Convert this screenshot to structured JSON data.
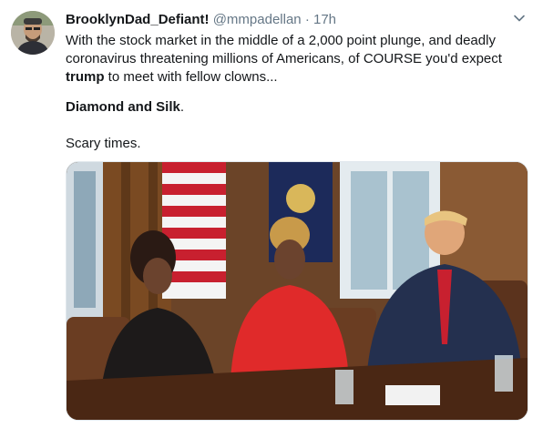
{
  "tweet": {
    "display_name": "BrooklynDad_Defiant!",
    "handle": "@mmpadellan",
    "separator": "·",
    "time": "17h",
    "text": {
      "line1_before": "With the stock market in the middle of a 2,000 point plunge, and deadly coronavirus threatening millions of Americans, of COURSE you'd expect",
      "line1_bold": "trump",
      "line1_after": " to meet with fellow clowns...",
      "para2_bold": "Diamond and Silk",
      "para2_after": ".",
      "para3": "Scary times."
    },
    "icons": {
      "menu": "chevron-down-icon",
      "avatar": "user-avatar"
    },
    "colors": {
      "name": "#14171a",
      "meta": "#657786",
      "border": "#e1e8ed"
    }
  }
}
